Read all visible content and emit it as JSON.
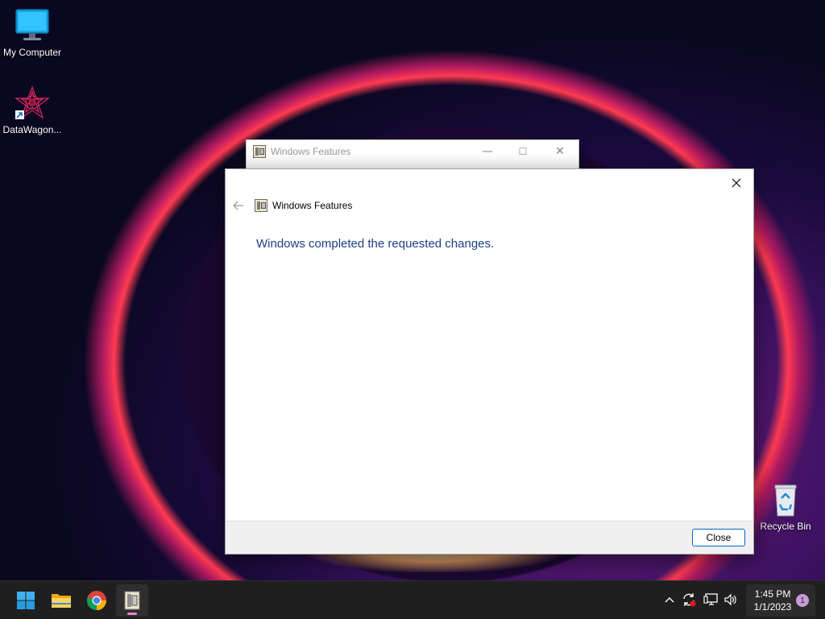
{
  "desktop": {
    "icons": [
      {
        "label": "My Computer",
        "icon": "monitor-icon"
      },
      {
        "label": "DataWagon...",
        "icon": "datawagon-icon"
      },
      {
        "label": "Recycle Bin",
        "icon": "recycle-bin-icon"
      }
    ]
  },
  "back_window": {
    "title": "Windows Features",
    "controls": {
      "minimize": "—",
      "maximize": "☐",
      "close": "✕"
    }
  },
  "dialog": {
    "title": "Windows Features",
    "message": "Windows completed the requested changes.",
    "close_button_label": "Close",
    "message_color": "#1c3f84"
  },
  "taskbar": {
    "apps": [
      {
        "name": "start",
        "icon": "windows-logo-icon"
      },
      {
        "name": "file-explorer",
        "icon": "folder-icon"
      },
      {
        "name": "chrome",
        "icon": "chrome-icon"
      },
      {
        "name": "windows-features",
        "icon": "windows-features-icon",
        "active": true
      }
    ],
    "tray": [
      "chevron-up-icon",
      "sync-icon",
      "network-icon",
      "volume-icon"
    ],
    "clock": {
      "time": "1:45 PM",
      "date": "1/1/2023",
      "notification_count": "1"
    }
  }
}
